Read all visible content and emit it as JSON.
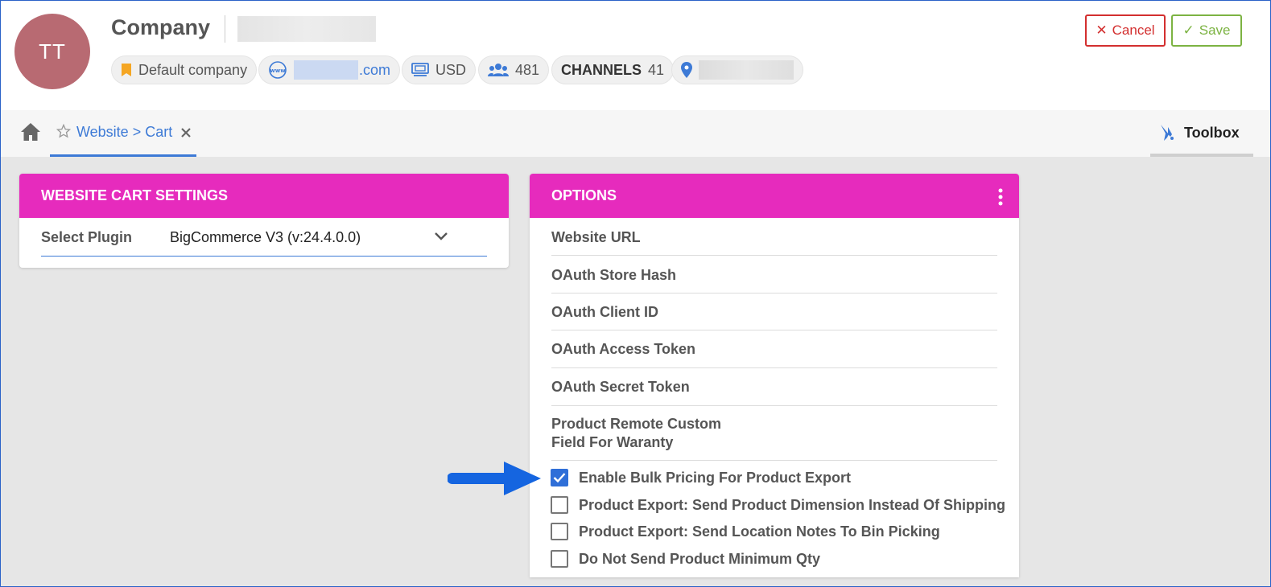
{
  "header": {
    "avatar_initials": "TT",
    "company_title": "Company",
    "chips": {
      "default_company": "Default company",
      "website_tld": ".com",
      "currency": "USD",
      "users_count": "481",
      "channels_label": "CHANNELS",
      "channels_count": "41"
    },
    "cancel_label": "Cancel",
    "save_label": "Save"
  },
  "tabs": {
    "active_tab_label": "Website > Cart",
    "toolbox_label": "Toolbox"
  },
  "settings_card": {
    "title": "WEBSITE CART SETTINGS",
    "plugin_label": "Select Plugin",
    "plugin_value": "BigCommerce V3 (v:24.4.0.0)"
  },
  "options_card": {
    "title": "OPTIONS",
    "fields": {
      "website_url": "Website URL",
      "oauth_store_hash": "OAuth Store Hash",
      "oauth_client_id": "OAuth Client ID",
      "oauth_access_token": "OAuth Access Token",
      "oauth_secret_token": "OAuth Secret Token",
      "custom_field_line1": "Product Remote Custom",
      "custom_field_line2": "Field For Waranty"
    },
    "checkboxes": [
      {
        "label": "Enable Bulk Pricing For Product Export",
        "checked": true
      },
      {
        "label": "Product Export: Send Product Dimension Instead Of Shipping",
        "checked": false
      },
      {
        "label": "Product Export: Send Location Notes To Bin Picking",
        "checked": false
      },
      {
        "label": "Do Not Send Product Minimum Qty",
        "checked": false
      }
    ]
  },
  "colors": {
    "accent_magenta": "#e62bbd",
    "link_blue": "#3d7ad6",
    "cancel_red": "#d32f2f",
    "save_green": "#7cb342",
    "arrow_blue": "#1565e0"
  }
}
